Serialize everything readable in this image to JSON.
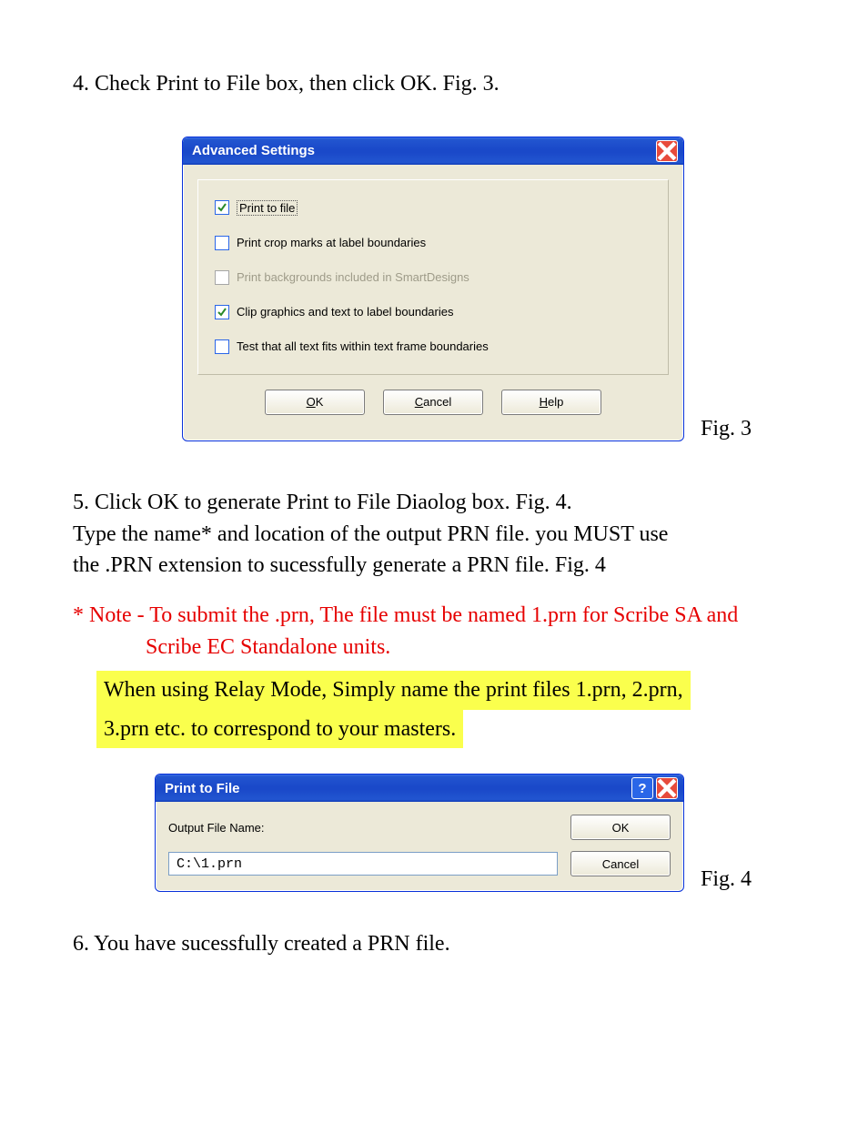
{
  "steps": {
    "s4": "4. Check Print to File box, then click OK. Fig. 3.",
    "s5a": "5. Click OK to generate Print to File Diaolog box. Fig. 4.",
    "s5b": "Type the name* and location of the output PRN file. you MUST use",
    "s5c": "the .PRN extension to sucessfully generate a PRN file. Fig. 4",
    "note1": "* Note - To submit the .prn, The file must be named 1.prn for Scribe SA and",
    "note2": "Scribe EC Standalone units.",
    "relay1": "When using Relay Mode, Simply name the print files 1.prn, 2.prn,",
    "relay2": "3.prn etc. to correspond to your masters.",
    "s6": "6. You have sucessfully created a PRN file."
  },
  "fig3_caption": "Fig. 3",
  "fig4_caption": "Fig. 4",
  "advanced": {
    "title": "Advanced Settings",
    "opts": [
      {
        "label": "Print to file",
        "checked": true,
        "dotted": true,
        "disabled": false
      },
      {
        "label": "Print crop marks at label boundaries",
        "checked": false,
        "dotted": false,
        "disabled": false
      },
      {
        "label": "Print backgrounds included in SmartDesigns",
        "checked": false,
        "dotted": false,
        "disabled": true
      },
      {
        "label": "Clip graphics and text to label boundaries",
        "checked": true,
        "dotted": false,
        "disabled": false
      },
      {
        "label": "Test that all text fits within text frame boundaries",
        "checked": false,
        "dotted": false,
        "disabled": false
      }
    ],
    "ok_u": "O",
    "ok_rest": "K",
    "cancel_u": "C",
    "cancel_rest": "ancel",
    "help_u": "H",
    "help_rest": "elp"
  },
  "ptf": {
    "title": "Print to File",
    "label": "Output File Name:",
    "value": "C:\\1.prn",
    "ok": "OK",
    "cancel": "Cancel"
  }
}
